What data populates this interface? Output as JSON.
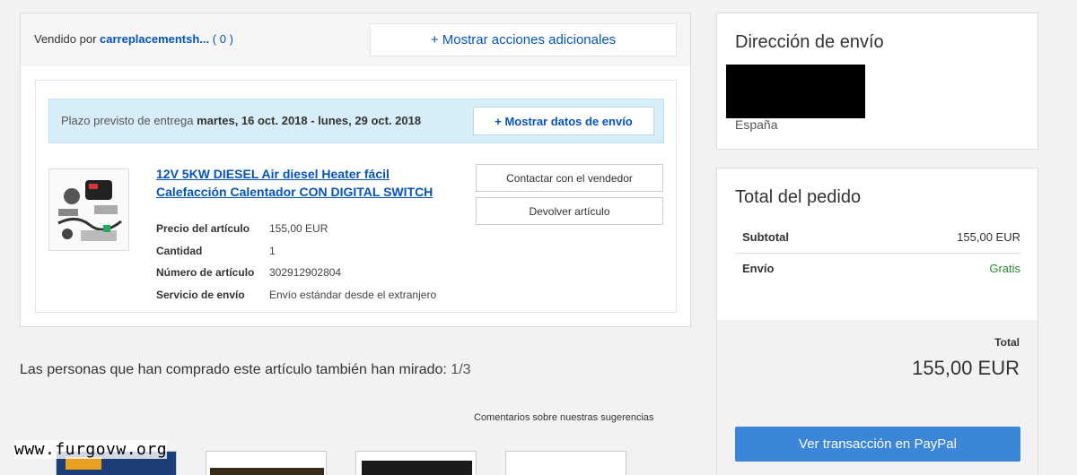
{
  "order": {
    "sold_by_label": "Vendido por",
    "seller": "carreplacementsh...",
    "feedback_score": "( 0 )",
    "more_actions": "+ Mostrar acciones adicionales",
    "delivery": {
      "label": "Plazo previsto de entrega",
      "range": "martes, 16 oct. 2018 - lunes, 29 oct. 2018",
      "show_ship_data": "+ Mostrar datos de envío"
    },
    "item": {
      "title": "12V 5KW DIESEL Air diesel Heater fácil Calefacción Calentador CON DIGITAL SWITCH",
      "specs": [
        {
          "label": "Precio del artículo",
          "value": "155,00 EUR"
        },
        {
          "label": "Cantidad",
          "value": "1"
        },
        {
          "label": "Número de artículo",
          "value": "302912902804"
        },
        {
          "label": "Servicio de envío",
          "value": "Envío estándar desde el extranjero"
        }
      ],
      "contact_seller": "Contactar con el vendedor",
      "return_item": "Devolver artículo"
    }
  },
  "also_viewed": {
    "text": "Las personas que han comprado este artículo también han mirado:",
    "count": "1/3",
    "feedback_link": "Comentarios sobre nuestras sugerencias"
  },
  "watermark": "www.furgovw.org",
  "shipping": {
    "title": "Dirección de envío",
    "country": "España"
  },
  "totals": {
    "title": "Total del pedido",
    "subtotal_label": "Subtotal",
    "subtotal_value": "155,00 EUR",
    "shipping_label": "Envío",
    "shipping_value": "Gratis",
    "total_label": "Total",
    "total_value": "155,00 EUR",
    "paypal_button": "Ver transacción en PayPal"
  },
  "colors": {
    "link": "#0654ba",
    "delivery_bg": "#d7edf7",
    "free": "#2e8a2e",
    "primary_button": "#3b86d8"
  }
}
